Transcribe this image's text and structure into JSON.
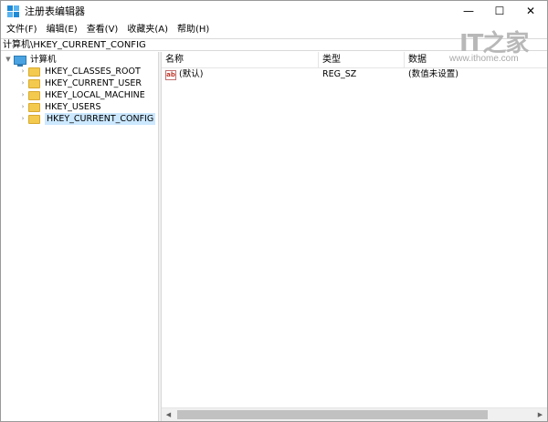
{
  "window": {
    "title": "注册表编辑器",
    "minimize_glyph": "—",
    "maximize_glyph": "☐",
    "close_glyph": "✕"
  },
  "watermark": {
    "logo": "IT之家",
    "url": "www.ithome.com"
  },
  "menubar": {
    "items": [
      "文件(F)",
      "编辑(E)",
      "查看(V)",
      "收藏夹(A)",
      "帮助(H)"
    ]
  },
  "address": {
    "path": "计算机\\HKEY_CURRENT_CONFIG"
  },
  "tree": {
    "root": {
      "label": "计算机",
      "icon": "computer-icon"
    },
    "items": [
      {
        "label": "HKEY_CLASSES_ROOT",
        "icon": "folder-icon"
      },
      {
        "label": "HKEY_CURRENT_USER",
        "icon": "folder-icon"
      },
      {
        "label": "HKEY_LOCAL_MACHINE",
        "icon": "folder-icon"
      },
      {
        "label": "HKEY_USERS",
        "icon": "folder-icon"
      },
      {
        "label": "HKEY_CURRENT_CONFIG",
        "icon": "folder-icon",
        "selected": true
      }
    ]
  },
  "list": {
    "columns": {
      "name": "名称",
      "type": "类型",
      "data": "数据"
    },
    "rows": [
      {
        "name": "(默认)",
        "type": "REG_SZ",
        "data": "(数值未设置)",
        "icon": "string-value-icon"
      }
    ]
  },
  "colors": {
    "selection": "#cce8ff",
    "folder": "#f3c94e",
    "computer": "#4aa3e0"
  }
}
